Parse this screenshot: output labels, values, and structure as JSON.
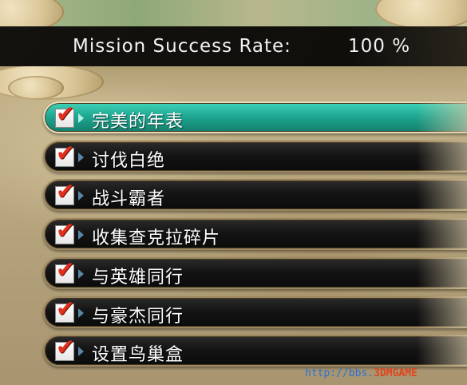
{
  "header": {
    "label": "Mission Success Rate:",
    "value": "100 %"
  },
  "missions": [
    {
      "label": "完美的年表",
      "checked": true,
      "selected": true
    },
    {
      "label": "讨伐白绝",
      "checked": true,
      "selected": false
    },
    {
      "label": "战斗霸者",
      "checked": true,
      "selected": false
    },
    {
      "label": "收集查克拉碎片",
      "checked": true,
      "selected": false
    },
    {
      "label": "与英雄同行",
      "checked": true,
      "selected": false
    },
    {
      "label": "与豪杰同行",
      "checked": true,
      "selected": false
    },
    {
      "label": "设置鸟巢盒",
      "checked": true,
      "selected": false
    }
  ],
  "watermark": {
    "url_part": "http://bbs.",
    "logo_part": "3DMGAME"
  },
  "colors": {
    "selected_bar": "#1fa892",
    "bar": "#141414",
    "checkmark": "#e0301e",
    "parchment": "#bfae86"
  }
}
